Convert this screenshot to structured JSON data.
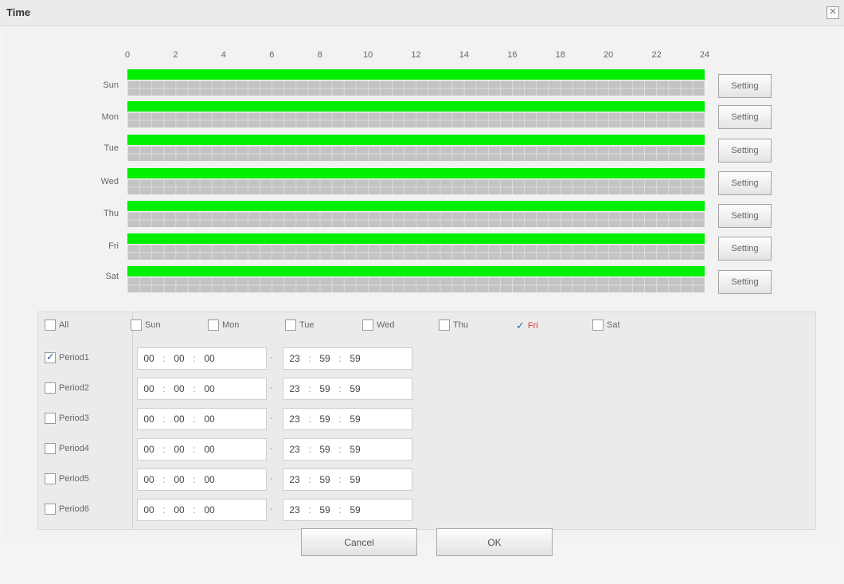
{
  "window": {
    "title": "Time",
    "close_icon": "✕"
  },
  "schedule": {
    "hours": [
      "0",
      "2",
      "4",
      "6",
      "8",
      "10",
      "12",
      "14",
      "16",
      "18",
      "20",
      "22",
      "24"
    ],
    "days": [
      {
        "label": "Sun",
        "coverage": [
          0,
          24
        ]
      },
      {
        "label": "Mon",
        "coverage": [
          0,
          24
        ]
      },
      {
        "label": "Tue",
        "coverage": [
          0,
          24
        ]
      },
      {
        "label": "Wed",
        "coverage": [
          0,
          24
        ]
      },
      {
        "label": "Thu",
        "coverage": [
          0,
          24
        ]
      },
      {
        "label": "Fri",
        "coverage": [
          0,
          24
        ]
      },
      {
        "label": "Sat",
        "coverage": [
          0,
          24
        ]
      }
    ],
    "setting_label": "Setting",
    "bar_color": "#00ee00"
  },
  "day_select": [
    {
      "label": "All",
      "checked": false
    },
    {
      "label": "Sun",
      "checked": false
    },
    {
      "label": "Mon",
      "checked": false
    },
    {
      "label": "Tue",
      "checked": false
    },
    {
      "label": "Wed",
      "checked": false
    },
    {
      "label": "Thu",
      "checked": false
    },
    {
      "label": "Fri",
      "checked": true
    },
    {
      "label": "Sat",
      "checked": false
    }
  ],
  "periods": [
    {
      "label": "Period1",
      "enabled": true,
      "start": [
        "00",
        "00",
        "00"
      ],
      "end": [
        "23",
        "59",
        "59"
      ]
    },
    {
      "label": "Period2",
      "enabled": false,
      "start": [
        "00",
        "00",
        "00"
      ],
      "end": [
        "23",
        "59",
        "59"
      ]
    },
    {
      "label": "Period3",
      "enabled": false,
      "start": [
        "00",
        "00",
        "00"
      ],
      "end": [
        "23",
        "59",
        "59"
      ]
    },
    {
      "label": "Period4",
      "enabled": false,
      "start": [
        "00",
        "00",
        "00"
      ],
      "end": [
        "23",
        "59",
        "59"
      ]
    },
    {
      "label": "Period5",
      "enabled": false,
      "start": [
        "00",
        "00",
        "00"
      ],
      "end": [
        "23",
        "59",
        "59"
      ]
    },
    {
      "label": "Period6",
      "enabled": false,
      "start": [
        "00",
        "00",
        "00"
      ],
      "end": [
        "23",
        "59",
        "59"
      ]
    }
  ],
  "period_separator": "-",
  "buttons": {
    "cancel": "Cancel",
    "ok": "OK"
  }
}
